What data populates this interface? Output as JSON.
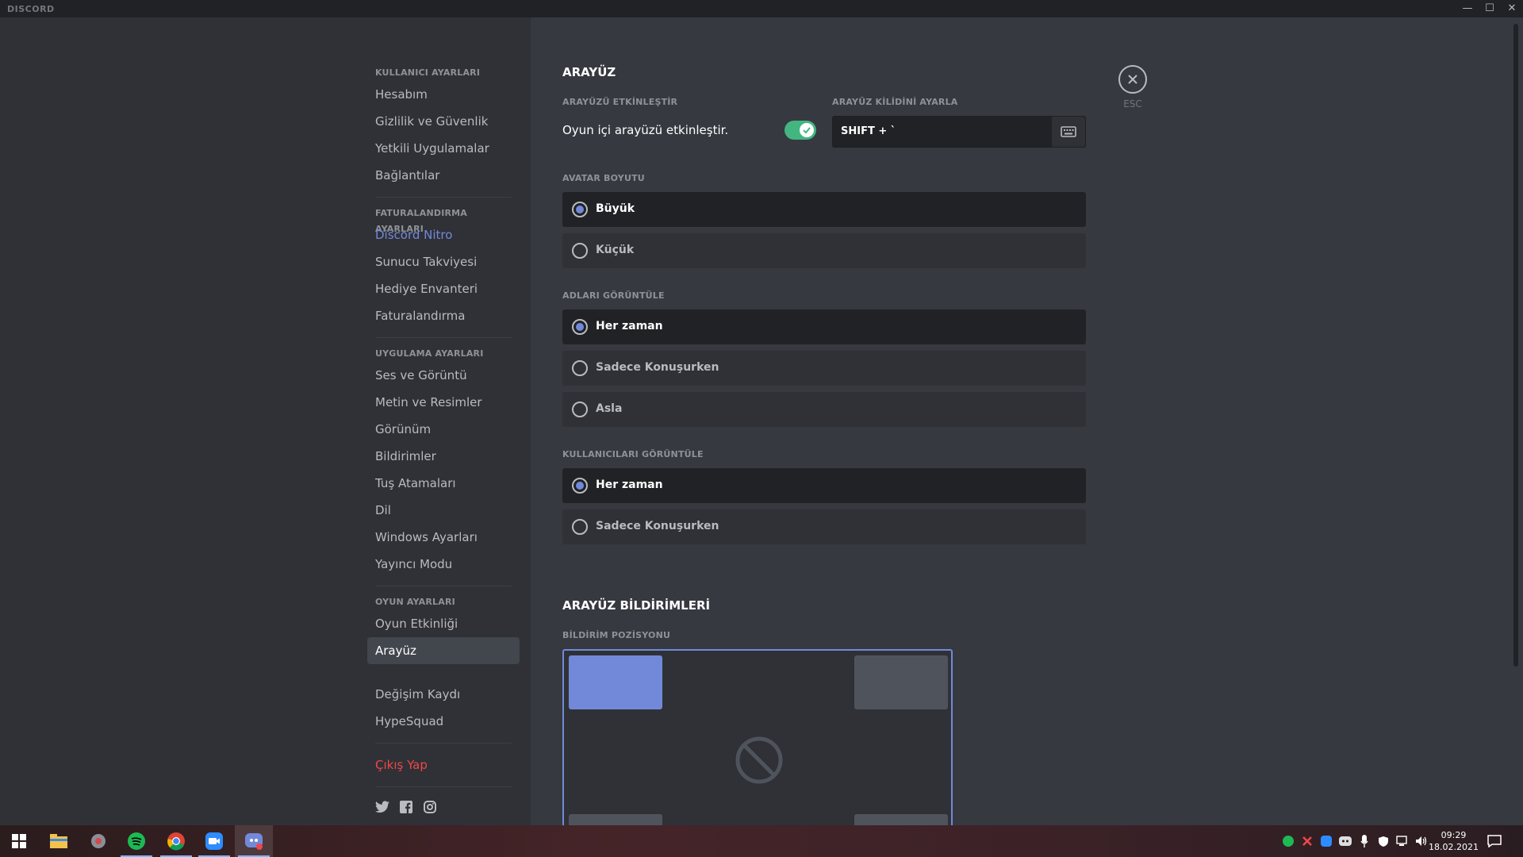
{
  "app": {
    "title": "DISCORD"
  },
  "sidebar": {
    "groups": [
      {
        "header": "KULLANICI AYARLARI",
        "items": [
          "Hesabım",
          "Gizlilik ve Güvenlik",
          "Yetkili Uygulamalar",
          "Bağlantılar"
        ]
      },
      {
        "header": "FATURALANDIRMA AYARLARI",
        "items": [
          "Discord Nitro",
          "Sunucu Takviyesi",
          "Hediye Envanteri",
          "Faturalandırma"
        ]
      },
      {
        "header": "UYGULAMA AYARLARI",
        "items": [
          "Ses ve Görüntü",
          "Metin ve Resimler",
          "Görünüm",
          "Bildirimler",
          "Tuş Atamaları",
          "Dil",
          "Windows Ayarları",
          "Yayıncı Modu"
        ]
      },
      {
        "header": "OYUN AYARLARI",
        "items": [
          "Oyun Etkinliği",
          "Arayüz"
        ]
      }
    ],
    "extra": [
      "Değişim Kaydı",
      "HypeSquad"
    ],
    "logout": "Çıkış Yap",
    "selected": "Arayüz"
  },
  "overlay": {
    "title": "ARAYÜZ",
    "enable_header": "ARAYÜZÜ ETKİNLEŞTİR",
    "enable_label": "Oyun içi arayüzü etkinleştir.",
    "enable_on": true,
    "lock_header": "ARAYÜZ KİLİDİNİ AYARLA",
    "lock_value": "SHIFT + `",
    "avatar_header": "AVATAR BOYUTU",
    "avatar_options": [
      "Büyük",
      "Küçük"
    ],
    "names_header": "ADLARI GÖRÜNTÜLE",
    "names_options": [
      "Her zaman",
      "Sadece Konuşurken",
      "Asla"
    ],
    "users_header": "KULLANICILARI GÖRÜNTÜLE",
    "users_options": [
      "Her zaman",
      "Sadece Konuşurken"
    ],
    "notif_title": "ARAYÜZ BİLDİRİMLERİ",
    "notif_pos_header": "BİLDİRİM POZİSYONU"
  },
  "close": {
    "label": "ESC"
  },
  "taskbar": {
    "time": "09:29",
    "date": "18.02.2021"
  },
  "colors": {
    "accent": "#7289da",
    "toggle_on": "#43b581",
    "danger": "#f04747"
  }
}
